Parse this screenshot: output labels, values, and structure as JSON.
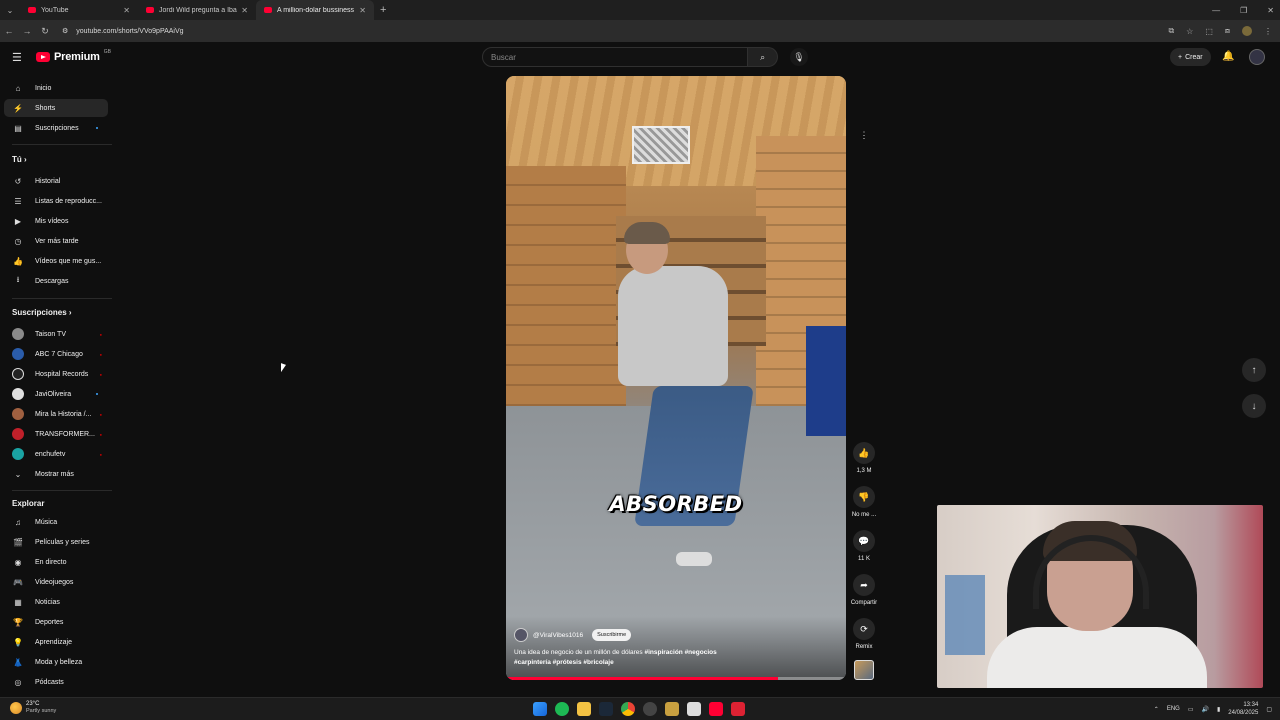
{
  "browser": {
    "tabs": [
      {
        "title": "YouTube",
        "close": "✕"
      },
      {
        "title": "Jordi Wild pregunta a Ibai si e",
        "close": "✕"
      },
      {
        "title": "A million-dolar bussiness a",
        "close": "✕"
      }
    ],
    "new_tab": "+",
    "url": "youtube.com/shorts/VVo9pPAAiVg"
  },
  "masthead": {
    "logo_text": "Premium",
    "logo_badge": "GB",
    "search_placeholder": "Buscar",
    "create_label": "Crear"
  },
  "sidebar": {
    "main": [
      {
        "label": "Inicio",
        "icon": "home-icon",
        "glyph": "⌂"
      },
      {
        "label": "Shorts",
        "icon": "shorts-icon",
        "glyph": "⚡"
      },
      {
        "label": "Suscripciones",
        "icon": "subscriptions-icon",
        "glyph": "▤"
      }
    ],
    "you_header": "Tú",
    "you": [
      {
        "label": "Historial",
        "icon": "history-icon",
        "glyph": "↺"
      },
      {
        "label": "Listas de reproducc...",
        "icon": "playlists-icon",
        "glyph": "☰"
      },
      {
        "label": "Mis vídeos",
        "icon": "your-videos-icon",
        "glyph": "▶"
      },
      {
        "label": "Ver más tarde",
        "icon": "watch-later-icon",
        "glyph": "◷"
      },
      {
        "label": "Vídeos que me gus...",
        "icon": "liked-icon",
        "glyph": "👍"
      },
      {
        "label": "Descargas",
        "icon": "downloads-icon",
        "glyph": "⭳"
      }
    ],
    "subs_header": "Suscripciones",
    "subs": [
      {
        "label": "Taison TV",
        "color": "#8a8a8a"
      },
      {
        "label": "ABC 7 Chicago",
        "color": "#2a5caa"
      },
      {
        "label": "Hospital Records",
        "color": "#222222"
      },
      {
        "label": "JaviOliveira",
        "color": "#e0e0e0"
      },
      {
        "label": "Mira la Historia /...",
        "color": "#a06040"
      },
      {
        "label": "TRANSFORMER...",
        "color": "#c0202a"
      },
      {
        "label": "enchufetv",
        "color": "#1aa3a3"
      }
    ],
    "show_more": "Mostrar más",
    "explore_header": "Explorar",
    "explore": [
      {
        "label": "Música",
        "icon": "music-icon",
        "glyph": "♫"
      },
      {
        "label": "Películas y series",
        "icon": "movies-icon",
        "glyph": "🎬"
      },
      {
        "label": "En directo",
        "icon": "live-icon",
        "glyph": "◉"
      },
      {
        "label": "Videojuegos",
        "icon": "gaming-icon",
        "glyph": "🎮"
      },
      {
        "label": "Noticias",
        "icon": "news-icon",
        "glyph": "▦"
      },
      {
        "label": "Deportes",
        "icon": "sports-icon",
        "glyph": "🏆"
      },
      {
        "label": "Aprendizaje",
        "icon": "learning-icon",
        "glyph": "💡"
      },
      {
        "label": "Moda y belleza",
        "icon": "fashion-icon",
        "glyph": "👗"
      },
      {
        "label": "Pódcasts",
        "icon": "podcasts-icon",
        "glyph": "◎"
      }
    ]
  },
  "short": {
    "overlay_text": "ABSORBED",
    "channel": "@ViralVibes1016",
    "subscribe": "Suscribirme",
    "description": "Una idea de negocio de un millón de dólares",
    "hashtags_1": "#inspiración #negocios",
    "hashtags_2": "#carpintería #prótesis #bricolaje",
    "progress": 0.8
  },
  "actions": {
    "likes": "1,3 M",
    "dislike": "No me ...",
    "comments": "11 K",
    "share": "Compartir",
    "remix": "Remix"
  },
  "taskbar": {
    "temp": "23°C",
    "weather": "Partly sunny",
    "lang": "ENG",
    "time": "13:34",
    "date": "24/08/2025"
  },
  "colors": {
    "accent": "#ff0033",
    "background": "#0f0f0f"
  }
}
